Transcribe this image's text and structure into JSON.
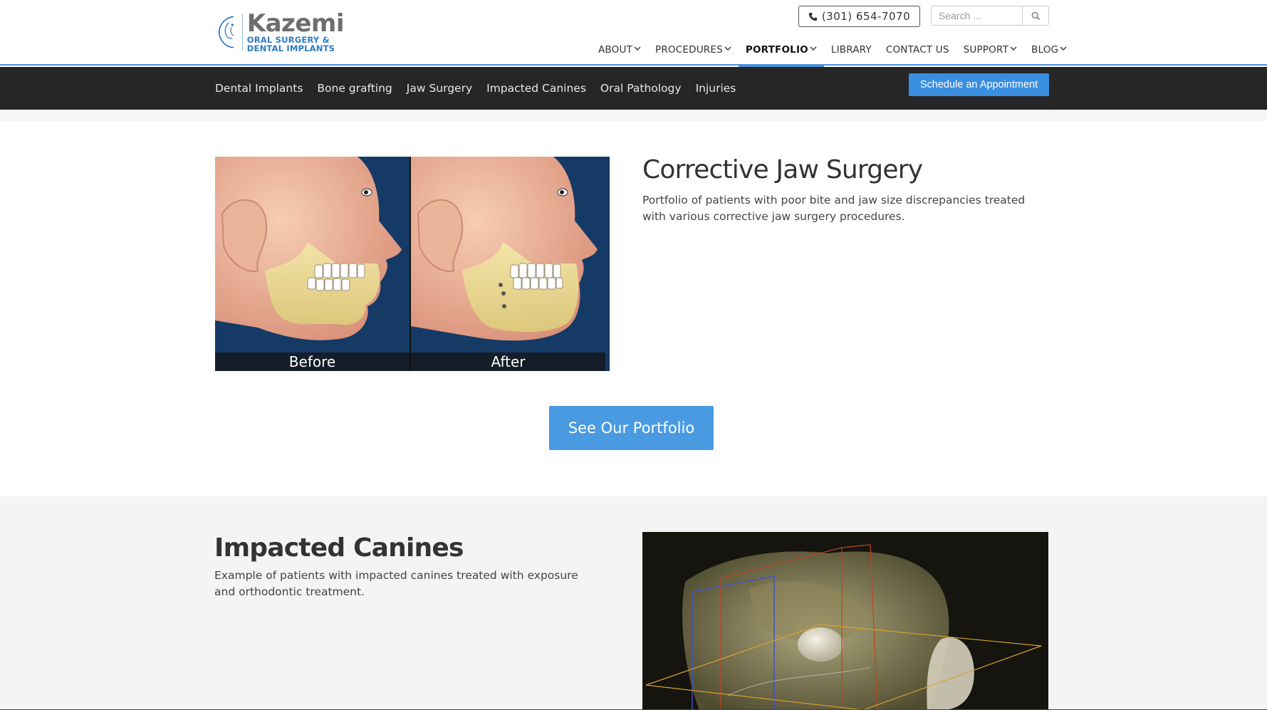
{
  "brand": {
    "name": "Kazemi",
    "subtitle_line1": "ORAL SURGERY &",
    "subtitle_line2": "DENTAL IMPLANTS",
    "brand_color": "#2f7ac4"
  },
  "header": {
    "phone": "(301) 654-7070",
    "search_placeholder": "Search ..."
  },
  "main_nav": [
    {
      "label": "ABOUT",
      "dropdown": true,
      "active": false
    },
    {
      "label": "PROCEDURES",
      "dropdown": true,
      "active": false
    },
    {
      "label": "PORTFOLIO",
      "dropdown": true,
      "active": true
    },
    {
      "label": "LIBRARY",
      "dropdown": false,
      "active": false
    },
    {
      "label": "CONTACT US",
      "dropdown": false,
      "active": false
    },
    {
      "label": "SUPPORT",
      "dropdown": true,
      "active": false
    },
    {
      "label": "BLOG",
      "dropdown": true,
      "active": false
    }
  ],
  "sub_nav": {
    "links": [
      "Dental Implants",
      "Bone grafting",
      "Jaw Surgery",
      "Impacted Canines",
      "Oral Pathology",
      "Injuries"
    ],
    "cta": "Schedule an Appointment"
  },
  "section_jaw": {
    "title": "Corrective Jaw Surgery",
    "description": "Portfolio of patients with poor bite and jaw size discrepancies treated with various corrective jaw surgery procedures.",
    "before_label": "Before",
    "after_label": "After",
    "button": "See Our Portfolio"
  },
  "section_canines": {
    "title": "Impacted Canines",
    "description": "Example of patients with impacted canines treated with exposure and orthodontic treatment."
  },
  "colors": {
    "accent": "#4a90d9",
    "button_blue": "#4a9ae2",
    "subnav_bg": "#262626"
  }
}
